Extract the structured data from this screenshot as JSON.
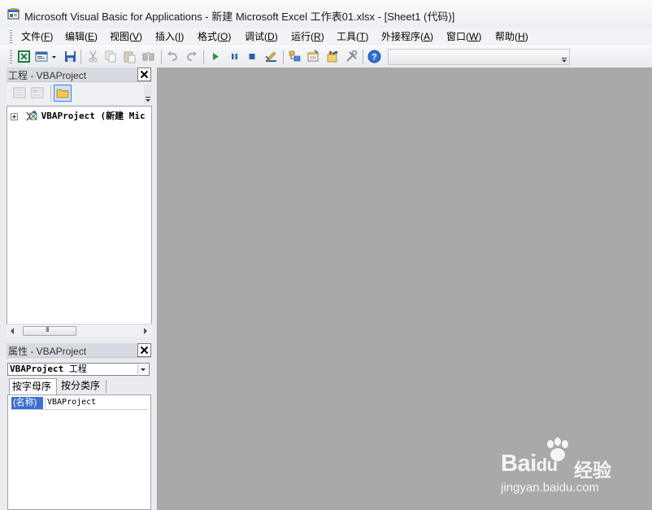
{
  "window": {
    "title": "Microsoft Visual Basic for Applications - 新建 Microsoft Excel 工作表01.xlsx - [Sheet1 (代码)]",
    "icon": "vba-editor-icon"
  },
  "menu": [
    {
      "label": "文件",
      "accel": "F"
    },
    {
      "label": "编辑",
      "accel": "E"
    },
    {
      "label": "视图",
      "accel": "V"
    },
    {
      "label": "插入",
      "accel": "I"
    },
    {
      "label": "格式",
      "accel": "O"
    },
    {
      "label": "调试",
      "accel": "D"
    },
    {
      "label": "运行",
      "accel": "R"
    },
    {
      "label": "工具",
      "accel": "T"
    },
    {
      "label": "外接程序",
      "accel": "A"
    },
    {
      "label": "窗口",
      "accel": "W"
    },
    {
      "label": "帮助",
      "accel": "H"
    }
  ],
  "toolbar_icons": [
    "excel-view-icon",
    "insert-module-icon",
    "save-icon",
    "cut-icon",
    "copy-icon",
    "paste-icon",
    "find-icon",
    "undo-icon",
    "redo-icon",
    "run-icon",
    "break-icon",
    "reset-icon",
    "design-mode-icon",
    "project-explorer-icon",
    "properties-window-icon",
    "object-browser-icon",
    "toolbox-icon",
    "help-icon"
  ],
  "project_pane": {
    "title": "工程 - VBAProject",
    "tree_item": "VBAProject (新建 Mic",
    "scroll_thumb_glyph": "III"
  },
  "properties_pane": {
    "title": "属性 - VBAProject",
    "selector_bold": "VBAProject",
    "selector_rest": " 工程",
    "tabs": [
      "按字母序",
      "按分类序"
    ],
    "rows": [
      {
        "name": "(名称)",
        "value": "VBAProject"
      }
    ]
  },
  "watermark": {
    "logo": "Bai",
    "logo_mid": "du",
    "cn": "经验",
    "url": "jingyan.baidu.com"
  },
  "colors": {
    "code_area_bg": "#a9a9a9",
    "selected_property": "#3d6fd0"
  }
}
